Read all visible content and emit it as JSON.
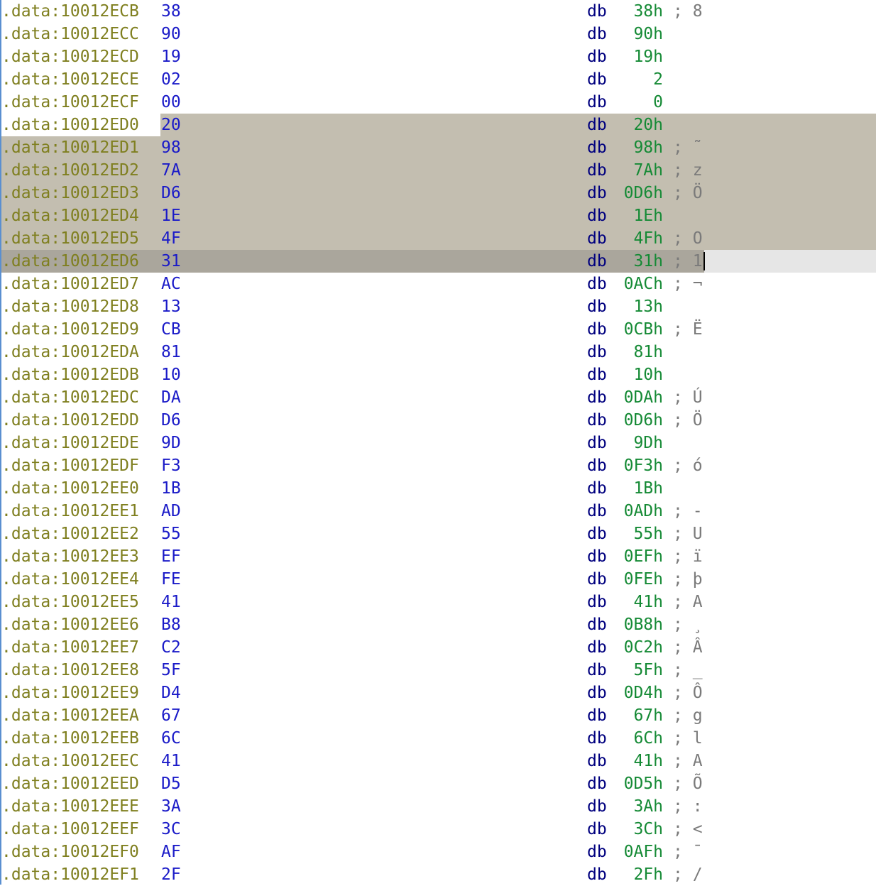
{
  "listing": {
    "rows": [
      {
        "addr": ".data:10012ECB",
        "bytes": "38",
        "mnem": "db",
        "val": "38h",
        "cmt": "; 8"
      },
      {
        "addr": ".data:10012ECC",
        "bytes": "90",
        "mnem": "db",
        "val": "90h",
        "cmt": ""
      },
      {
        "addr": ".data:10012ECD",
        "bytes": "19",
        "mnem": "db",
        "val": "19h",
        "cmt": ""
      },
      {
        "addr": ".data:10012ECE",
        "bytes": "02",
        "mnem": "db",
        "val": "2",
        "cmt": ""
      },
      {
        "addr": ".data:10012ECF",
        "bytes": "00",
        "mnem": "db",
        "val": "0",
        "cmt": ""
      },
      {
        "addr": ".data:10012ED0",
        "bytes": "20",
        "mnem": "db",
        "val": "20h",
        "cmt": ""
      },
      {
        "addr": ".data:10012ED1",
        "bytes": "98",
        "mnem": "db",
        "val": "98h",
        "cmt": "; ˜"
      },
      {
        "addr": ".data:10012ED2",
        "bytes": "7A",
        "mnem": "db",
        "val": "7Ah",
        "cmt": "; z"
      },
      {
        "addr": ".data:10012ED3",
        "bytes": "D6",
        "mnem": "db",
        "val": "0D6h",
        "cmt": "; Ö"
      },
      {
        "addr": ".data:10012ED4",
        "bytes": "1E",
        "mnem": "db",
        "val": "1Eh",
        "cmt": ""
      },
      {
        "addr": ".data:10012ED5",
        "bytes": "4F",
        "mnem": "db",
        "val": "4Fh",
        "cmt": "; O"
      },
      {
        "addr": ".data:10012ED6",
        "bytes": "31",
        "mnem": "db",
        "val": "31h",
        "cmt": "; 1"
      },
      {
        "addr": ".data:10012ED7",
        "bytes": "AC",
        "mnem": "db",
        "val": "0ACh",
        "cmt": "; ¬"
      },
      {
        "addr": ".data:10012ED8",
        "bytes": "13",
        "mnem": "db",
        "val": "13h",
        "cmt": ""
      },
      {
        "addr": ".data:10012ED9",
        "bytes": "CB",
        "mnem": "db",
        "val": "0CBh",
        "cmt": "; Ë"
      },
      {
        "addr": ".data:10012EDA",
        "bytes": "81",
        "mnem": "db",
        "val": "81h",
        "cmt": ""
      },
      {
        "addr": ".data:10012EDB",
        "bytes": "10",
        "mnem": "db",
        "val": "10h",
        "cmt": ""
      },
      {
        "addr": ".data:10012EDC",
        "bytes": "DA",
        "mnem": "db",
        "val": "0DAh",
        "cmt": "; Ú"
      },
      {
        "addr": ".data:10012EDD",
        "bytes": "D6",
        "mnem": "db",
        "val": "0D6h",
        "cmt": "; Ö"
      },
      {
        "addr": ".data:10012EDE",
        "bytes": "9D",
        "mnem": "db",
        "val": "9Dh",
        "cmt": ""
      },
      {
        "addr": ".data:10012EDF",
        "bytes": "F3",
        "mnem": "db",
        "val": "0F3h",
        "cmt": "; ó"
      },
      {
        "addr": ".data:10012EE0",
        "bytes": "1B",
        "mnem": "db",
        "val": "1Bh",
        "cmt": ""
      },
      {
        "addr": ".data:10012EE1",
        "bytes": "AD",
        "mnem": "db",
        "val": "0ADh",
        "cmt": "; -"
      },
      {
        "addr": ".data:10012EE2",
        "bytes": "55",
        "mnem": "db",
        "val": "55h",
        "cmt": "; U"
      },
      {
        "addr": ".data:10012EE3",
        "bytes": "EF",
        "mnem": "db",
        "val": "0EFh",
        "cmt": "; ï"
      },
      {
        "addr": ".data:10012EE4",
        "bytes": "FE",
        "mnem": "db",
        "val": "0FEh",
        "cmt": "; þ"
      },
      {
        "addr": ".data:10012EE5",
        "bytes": "41",
        "mnem": "db",
        "val": "41h",
        "cmt": "; A"
      },
      {
        "addr": ".data:10012EE6",
        "bytes": "B8",
        "mnem": "db",
        "val": "0B8h",
        "cmt": "; ¸"
      },
      {
        "addr": ".data:10012EE7",
        "bytes": "C2",
        "mnem": "db",
        "val": "0C2h",
        "cmt": "; Â"
      },
      {
        "addr": ".data:10012EE8",
        "bytes": "5F",
        "mnem": "db",
        "val": "5Fh",
        "cmt": "; _"
      },
      {
        "addr": ".data:10012EE9",
        "bytes": "D4",
        "mnem": "db",
        "val": "0D4h",
        "cmt": "; Ô"
      },
      {
        "addr": ".data:10012EEA",
        "bytes": "67",
        "mnem": "db",
        "val": "67h",
        "cmt": "; g"
      },
      {
        "addr": ".data:10012EEB",
        "bytes": "6C",
        "mnem": "db",
        "val": "6Ch",
        "cmt": "; l"
      },
      {
        "addr": ".data:10012EEC",
        "bytes": "41",
        "mnem": "db",
        "val": "41h",
        "cmt": "; A"
      },
      {
        "addr": ".data:10012EED",
        "bytes": "D5",
        "mnem": "db",
        "val": "0D5h",
        "cmt": "; Õ"
      },
      {
        "addr": ".data:10012EEE",
        "bytes": "3A",
        "mnem": "db",
        "val": "3Ah",
        "cmt": "; :"
      },
      {
        "addr": ".data:10012EEF",
        "bytes": "3C",
        "mnem": "db",
        "val": "3Ch",
        "cmt": "; <"
      },
      {
        "addr": ".data:10012EF0",
        "bytes": "AF",
        "mnem": "db",
        "val": "0AFh",
        "cmt": "; ¯"
      },
      {
        "addr": ".data:10012EF1",
        "bytes": "2F",
        "mnem": "db",
        "val": "2Fh",
        "cmt": "; /"
      }
    ]
  },
  "selection": {
    "first_selected_addr": ".data:10012ED0",
    "last_selected_addr": ".data:10012ED5",
    "cursor_addr": ".data:10012ED6",
    "selection_color": "#c3beb0",
    "cursor_line_color": "#aaa69c"
  },
  "colors": {
    "address": "#7f7f1f",
    "bytes": "#1a1ac8",
    "mnemonic": "#00007f",
    "value": "#158a35",
    "comment": "#7a7a7a"
  }
}
